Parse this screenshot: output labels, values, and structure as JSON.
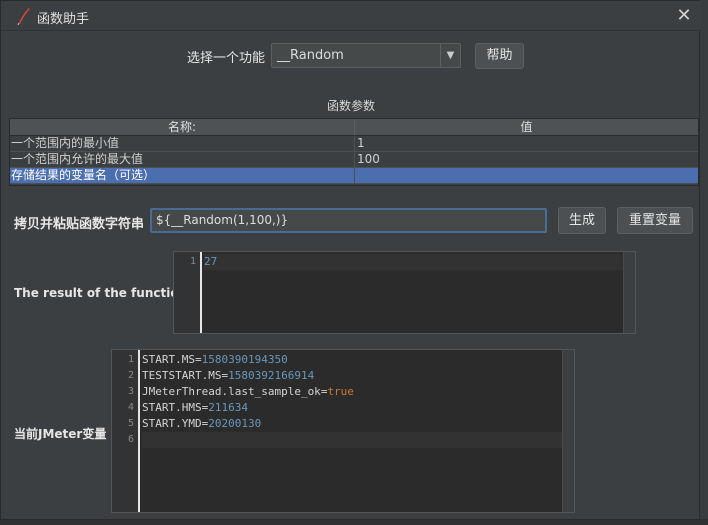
{
  "dialog": {
    "title": "函数助手",
    "close_glyph": "✕"
  },
  "function_select": {
    "label": "选择一个功能",
    "value": "__Random",
    "arrow_glyph": "▼",
    "help_label": "帮助"
  },
  "params": {
    "title": "函数参数",
    "columns": [
      "名称:",
      "值"
    ],
    "rows": [
      {
        "name": "一个范围内的最小值",
        "value": "1"
      },
      {
        "name": "一个范围内允许的最大值",
        "value": "100"
      },
      {
        "name": "存储结果的变量名（可选）",
        "value": ""
      }
    ],
    "selected_row": 2
  },
  "copy": {
    "label": "拷贝并粘贴函数字符串",
    "value": "${__Random(1,100,)}",
    "generate_label": "生成",
    "reset_label": "重置变量"
  },
  "result": {
    "label": "The result of the function is",
    "lines": [
      {
        "n": "1",
        "text": "27"
      }
    ]
  },
  "vars": {
    "label": "当前JMeter变量",
    "lines": [
      {
        "n": "1",
        "key": "START.MS",
        "value": "1580390194350",
        "value_type": "num"
      },
      {
        "n": "2",
        "key": "TESTSTART.MS",
        "value": "1580392166914",
        "value_type": "num"
      },
      {
        "n": "3",
        "key": "JMeterThread.last_sample_ok",
        "value": "true",
        "value_type": "kw"
      },
      {
        "n": "4",
        "key": "START.HMS",
        "value": "211634",
        "value_type": "num"
      },
      {
        "n": "5",
        "key": "START.YMD",
        "value": "20200130",
        "value_type": "num"
      },
      {
        "n": "6",
        "key": "",
        "value": "",
        "value_type": "num"
      }
    ]
  },
  "colors": {
    "background": "#3c3f41",
    "selection": "#4b6eaf",
    "number": "#6897bb",
    "keyword": "#cc7832",
    "logo": "#d9432f"
  }
}
